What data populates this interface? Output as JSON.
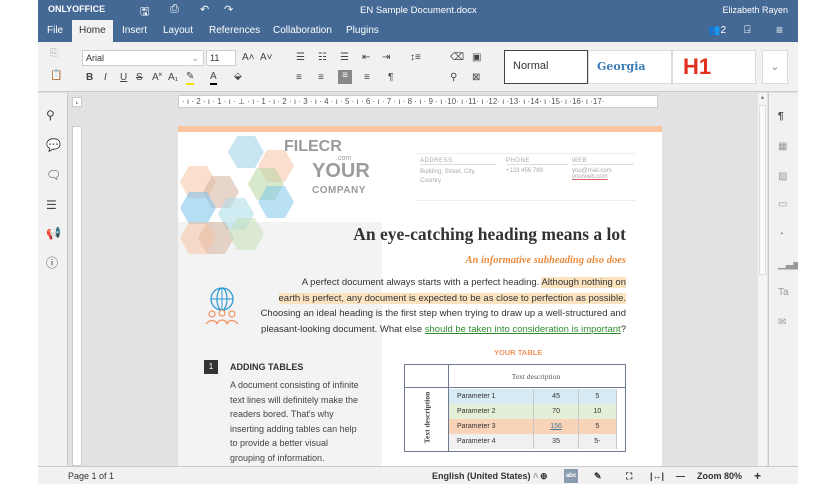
{
  "app": {
    "brand": "ONLYOFFICE",
    "document_title": "EN Sample Document.docx",
    "user": "Elizabeth Rayen",
    "accent": "#446995"
  },
  "tabs": [
    {
      "label": "File"
    },
    {
      "label": "Home"
    },
    {
      "label": "Insert"
    },
    {
      "label": "Layout"
    },
    {
      "label": "References"
    },
    {
      "label": "Collaboration"
    },
    {
      "label": "Plugins"
    }
  ],
  "header": {
    "users_count": "2"
  },
  "toolbar": {
    "font_name": "Arial",
    "font_size": "11",
    "styles": [
      {
        "label": "Normal"
      },
      {
        "label": "Georgia"
      },
      {
        "label": "H1"
      }
    ]
  },
  "ruler": {
    "text": "· ı · 2 · ı · 1 · ı · ⊥ · ı · 1 · ı · 2 · ı · 3 · ı · 4 · ı · 5 · ı · 6 · ı · 7 · ı · 8 · ı · 9 · ı ·10· ı ·11· ı ·12· ı ·13· ı ·14· ı ·15· ı ·16· ı ·17·"
  },
  "document": {
    "watermark": "FILECR",
    "watermark_sub": ".com",
    "logo_line1": "YOUR",
    "logo_line2": "COMPANY",
    "contacts": [
      {
        "label": "ADDRESS",
        "value": "Building, Street, City, Country"
      },
      {
        "label": "PHONE",
        "value": "+123 456 789"
      },
      {
        "label": "WEB",
        "value": "you@mail.com",
        "value2": "yourweb.com"
      }
    ],
    "heading": "An eye-catching heading means a lot",
    "subheading": "An informative subheading also does",
    "para_1": "A perfect document always starts with a perfect heading. ",
    "para_hl1": "Although nothing on",
    "para_hl2": "earth is perfect, any document is expected to be as close to perfection as possible.",
    "para_3": "Choosing an ideal heading is the first step when trying to draw up a well-structured and",
    "para_4a": "pleasant-looking document. What else ",
    "para_4b": "should be taken into consideration is important",
    "para_4c": "?",
    "section_number": "1",
    "section_title": "ADDING TABLES",
    "section_body": "A document consisting of infinite text lines will definitely make the readers bored. That's why inserting adding tables can help to provide a better visual grouping of information.",
    "table_title": "YOUR TABLE",
    "table_header": "Text description",
    "table_side": "Text description",
    "table_rows": [
      {
        "c": [
          "Parameter 1",
          "45",
          "5"
        ],
        "color": "#d6ebf3"
      },
      {
        "c": [
          "Parameter 2",
          "70",
          "10"
        ],
        "color": "#e3efd6"
      },
      {
        "c": [
          "Parameter 3",
          "156",
          "5"
        ],
        "color": "#f9d3b8"
      },
      {
        "c": [
          "Parameter 4",
          "35",
          "5-"
        ],
        "color": "#f0f0f0"
      }
    ]
  },
  "status": {
    "page": "Page 1 of 1",
    "language": "English (United States)",
    "zoom": "Zoom 80%"
  }
}
